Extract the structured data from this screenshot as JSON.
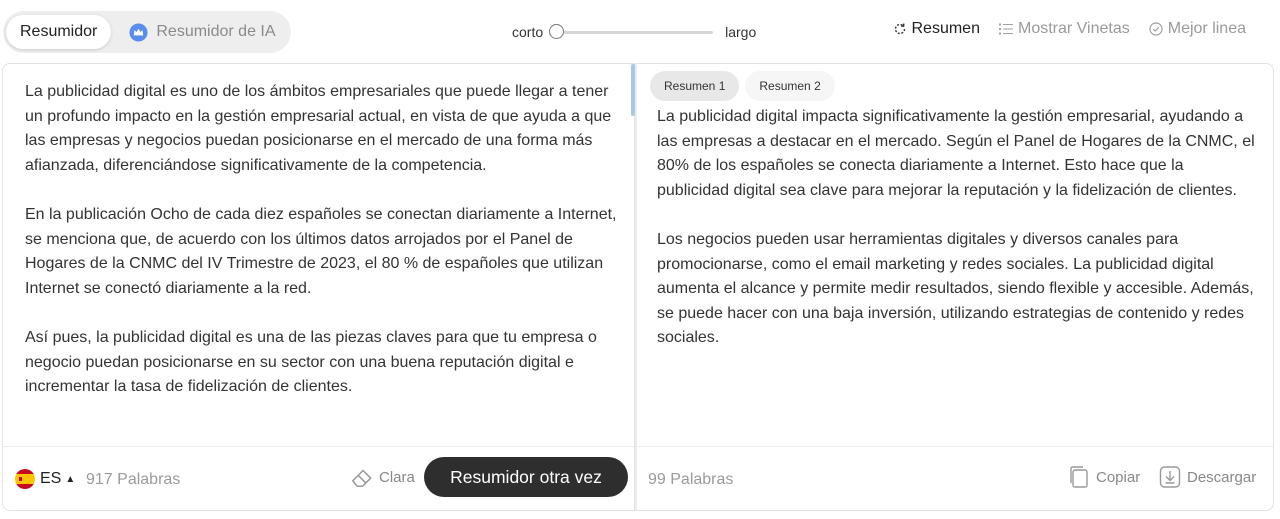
{
  "mode_switch": {
    "summarizer": "Resumidor",
    "ai_summarizer": "Resumidor de IA"
  },
  "length": {
    "short": "corto",
    "long": "largo",
    "value": 0
  },
  "summary_modes": {
    "summary": "Resumen",
    "bullets": "Mostrar Vinetas",
    "best_line": "Mejor linea"
  },
  "input": {
    "paragraphs": [
      "La publicidad digital es uno de los ámbitos empresariales que puede llegar a tener un profundo impacto en la gestión empresarial actual, en vista de que ayuda a que las empresas y negocios puedan posicionarse en el mercado de una forma más afianzada, diferenciándose significativamente de la competencia.",
      "En la publicación Ocho de cada diez españoles se conectan diariamente a Internet, se menciona que, de acuerdo con los últimos datos arrojados por el Panel de Hogares de la CNMC del IV Trimestre de 2023, el 80 % de españoles que utilizan Internet se conectó diariamente a la red.",
      "Así pues, la publicidad digital es una de las piezas claves para que tu empresa o negocio puedan posicionarse en su sector con una buena reputación digital e incrementar la tasa de fidelización de clientes."
    ]
  },
  "left_footer": {
    "language": "ES",
    "word_count": "917 Palabras",
    "clear_label": "Clara",
    "resummarize_label": "Resumidor otra vez"
  },
  "output": {
    "tabs": [
      "Resumen 1",
      "Resumen 2"
    ],
    "paragraphs": [
      "La publicidad digital impacta significativamente la gestión empresarial, ayudando a las empresas a destacar en el mercado. Según el Panel de Hogares de la CNMC, el 80% de los españoles se conecta diariamente a Internet. Esto hace que la publicidad digital sea clave para mejorar la reputación y la fidelización de clientes.",
      "Los negocios pueden usar herramientas digitales y diversos canales para promocionarse, como el email marketing y redes sociales. La publicidad digital aumenta el alcance y permite medir resultados, siendo flexible y accesible. Además, se puede hacer con una baja inversión, utilizando estrategias de contenido y redes sociales."
    ]
  },
  "right_footer": {
    "word_count": "99 Palabras",
    "copy_label": "Copiar",
    "download_label": "Descargar"
  }
}
